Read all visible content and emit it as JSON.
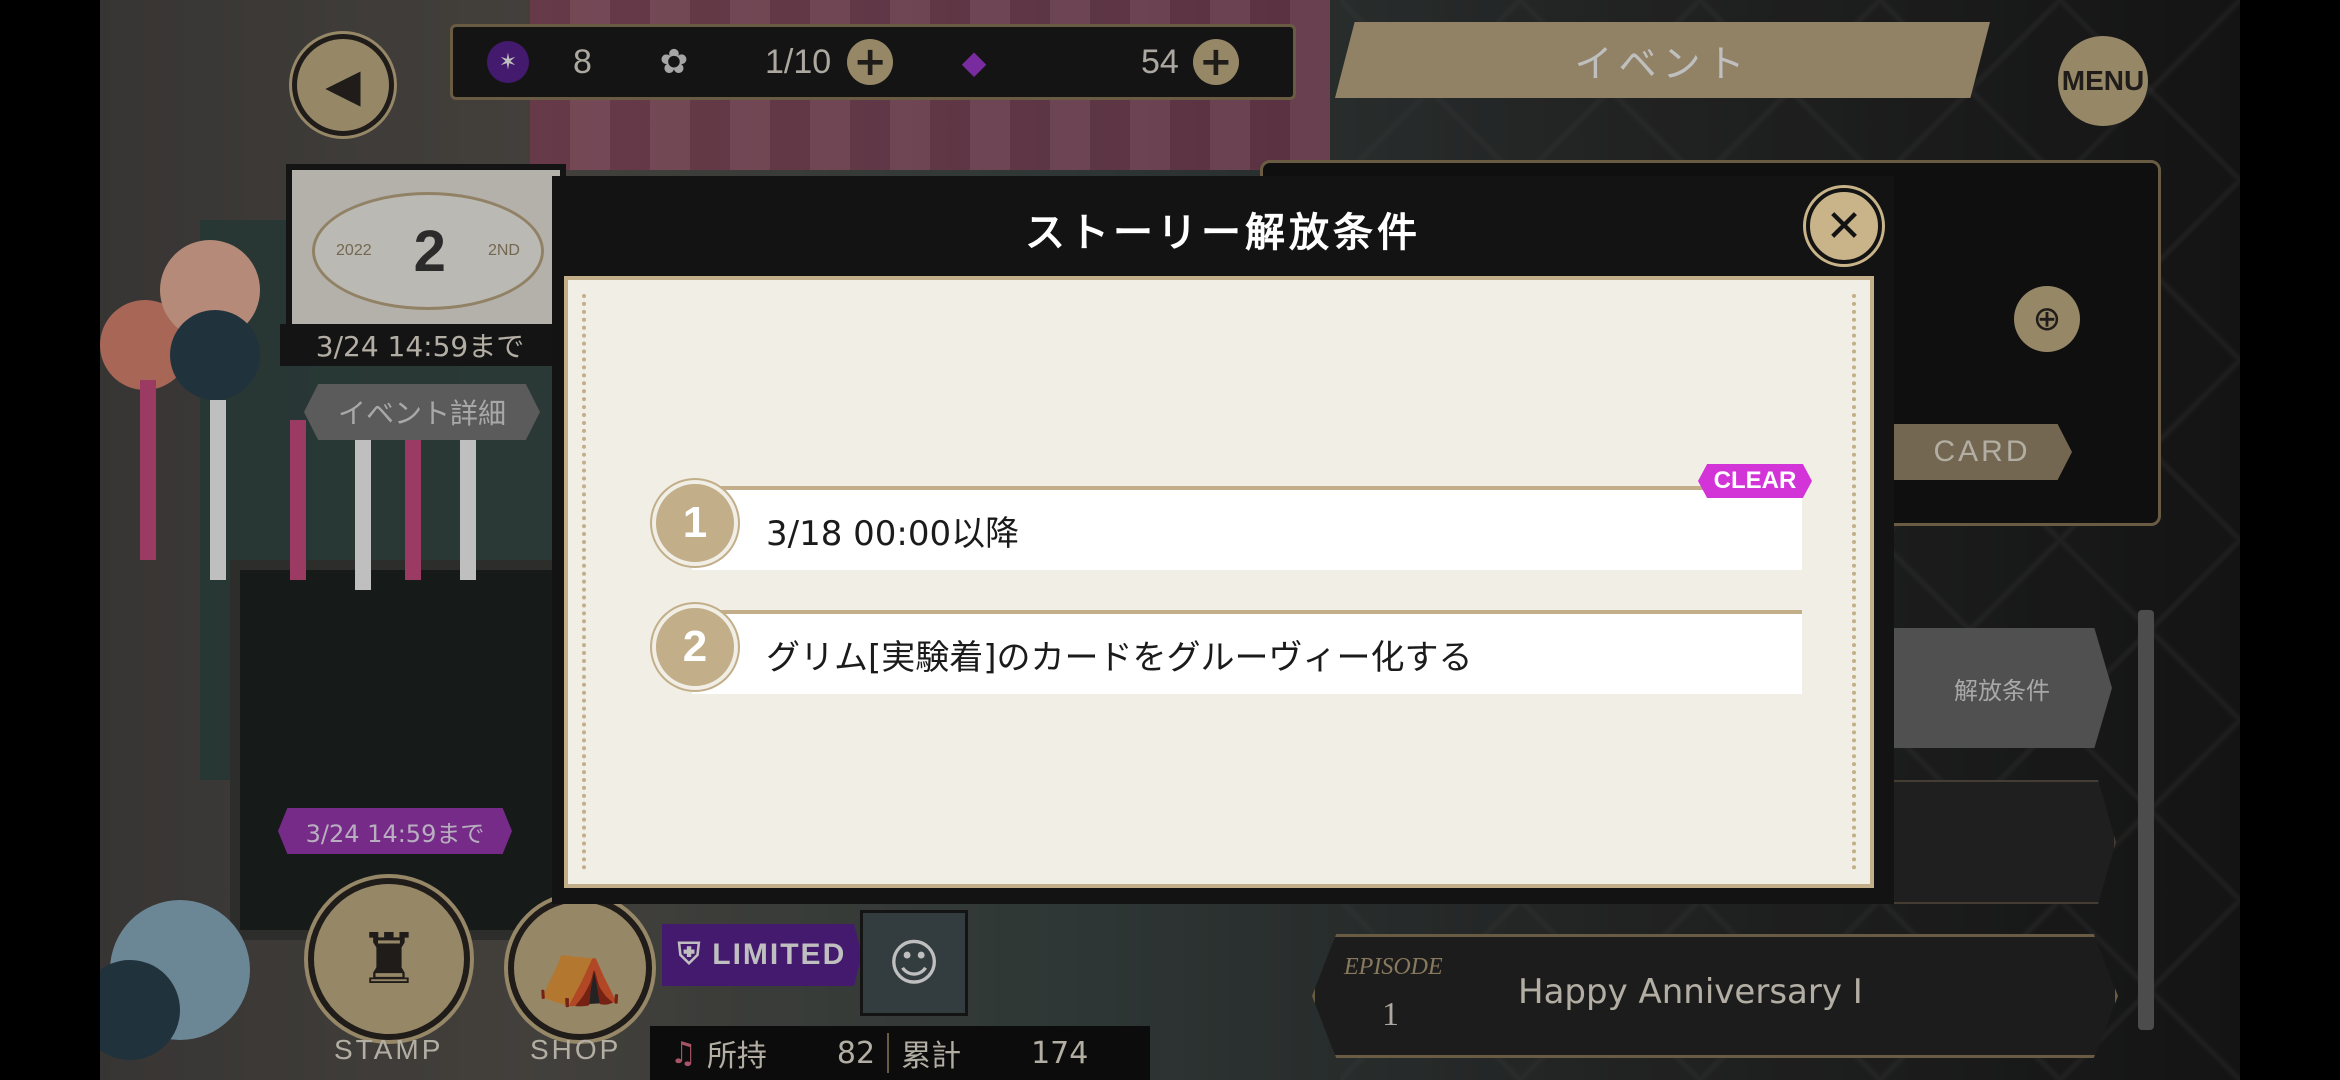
{
  "header": {
    "back_icon": "◀",
    "currency": {
      "gem_count": "8",
      "stamina": "1/10",
      "crystal_count": "54"
    },
    "event_tab": "イベント",
    "menu": "MENU"
  },
  "event_panel": {
    "banner_year": "2022",
    "banner_number": "2",
    "banner_anniv": "2ND",
    "deadline": "3/24 14:59まで",
    "detail_button": "イベント詳細"
  },
  "right_panel": {
    "card_button": "CARD",
    "unlock_condition_button": "解放条件"
  },
  "bottom_left": {
    "stamp_deadline": "3/24 14:59まで",
    "stamp_label": "STAMP",
    "shop_label": "SHOP",
    "limited_label": "LIMITED",
    "owned_label": "所持",
    "owned_value": "82",
    "total_label": "累計",
    "total_value": "174"
  },
  "episode": {
    "label": "EPISODE",
    "number": "1",
    "title": "Happy Anniversary Ⅰ"
  },
  "modal": {
    "title": "ストーリー解放条件",
    "conditions": [
      {
        "number": "1",
        "text": "3/18 00:00以降",
        "badge": "CLEAR"
      },
      {
        "number": "2",
        "text": "グリム[実験着]のカードをグルーヴィー化する"
      }
    ]
  },
  "colors": {
    "gold": "#c2ae88",
    "badge_magenta": "#d234d8",
    "limited_purple": "#5b2395"
  }
}
